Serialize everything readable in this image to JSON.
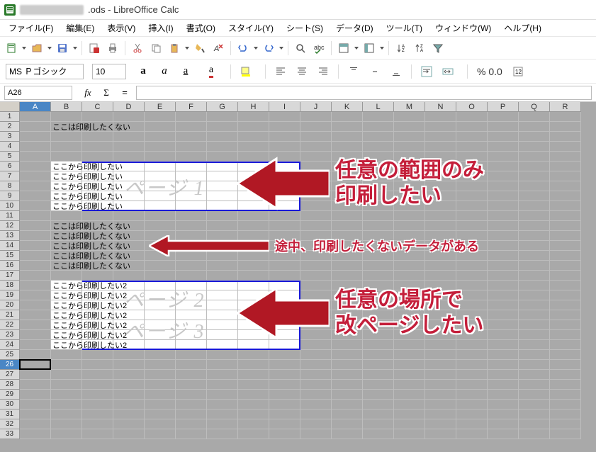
{
  "window": {
    "title": ".ods - LibreOffice Calc"
  },
  "menu": {
    "file": "ファイル(F)",
    "edit": "編集(E)",
    "view": "表示(V)",
    "insert": "挿入(I)",
    "format": "書式(O)",
    "style": "スタイル(Y)",
    "sheet": "シート(S)",
    "data": "データ(D)",
    "tool": "ツール(T)",
    "window": "ウィンドウ(W)",
    "help": "ヘルプ(H)"
  },
  "format_bar": {
    "font_name": "MS Ｐゴシック",
    "font_size": "10",
    "percent_zero": "% 0.0"
  },
  "cell_reference": "A26",
  "columns": [
    "A",
    "B",
    "C",
    "D",
    "E",
    "F",
    "G",
    "H",
    "I",
    "J",
    "K",
    "L",
    "M",
    "N",
    "O",
    "P",
    "Q",
    "R"
  ],
  "cells": {
    "r2": "ここは印刷したくない",
    "r6": "ここから印刷したい",
    "r7": "ここから印刷したい",
    "r8": "ここから印刷したい",
    "r9": "ここから印刷したい",
    "r10": "ここから印刷したい",
    "r12": "ここは印刷したくない",
    "r13": "ここは印刷したくない",
    "r14": "ここは印刷したくない",
    "r15": "ここは印刷したくない",
    "r16": "ここは印刷したくない",
    "r18": "ここから印刷したい2",
    "r19": "ここから印刷したい2",
    "r20": "ここから印刷したい2",
    "r21": "ここから印刷したい2",
    "r22": "ここから印刷したい2",
    "r23": "ここから印刷したい2",
    "r24": "ここから印刷したい2"
  },
  "watermarks": {
    "p1": "ページ 1",
    "p2": "ページ 2",
    "p3": "ページ 3"
  },
  "annotations": {
    "a1_l1": "任意の範囲のみ",
    "a1_l2": "印刷したい",
    "a2": "途中、印刷したくないデータがある",
    "a3_l1": "任意の場所で",
    "a3_l2": "改ページしたい"
  }
}
